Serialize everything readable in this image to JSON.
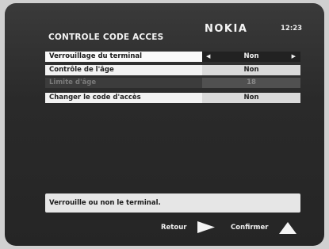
{
  "header": {
    "title": "CONTROLE CODE ACCES",
    "brand": "NOKIA",
    "clock": "12:23"
  },
  "menu": {
    "items": [
      {
        "label": "Verrouillage du terminal",
        "value": "Non",
        "state": "selected"
      },
      {
        "label": "Contrôle de l'âge",
        "value": "Non",
        "state": "normal"
      },
      {
        "label": "Limite d'âge",
        "value": "18",
        "state": "disabled"
      },
      {
        "label": "Changer le code d'accès",
        "value": "Non",
        "state": "normal"
      }
    ]
  },
  "help": {
    "text": "Verrouille ou non le terminal."
  },
  "softkeys": {
    "back_label": "Retour",
    "back_icon": "right-triangle-icon",
    "confirm_label": "Confirmer",
    "confirm_icon": "up-triangle-icon"
  },
  "colors": {
    "screen_background": "#2a2a2a",
    "selected_row": "#fafafa",
    "value_cell_selected": "#222222"
  }
}
